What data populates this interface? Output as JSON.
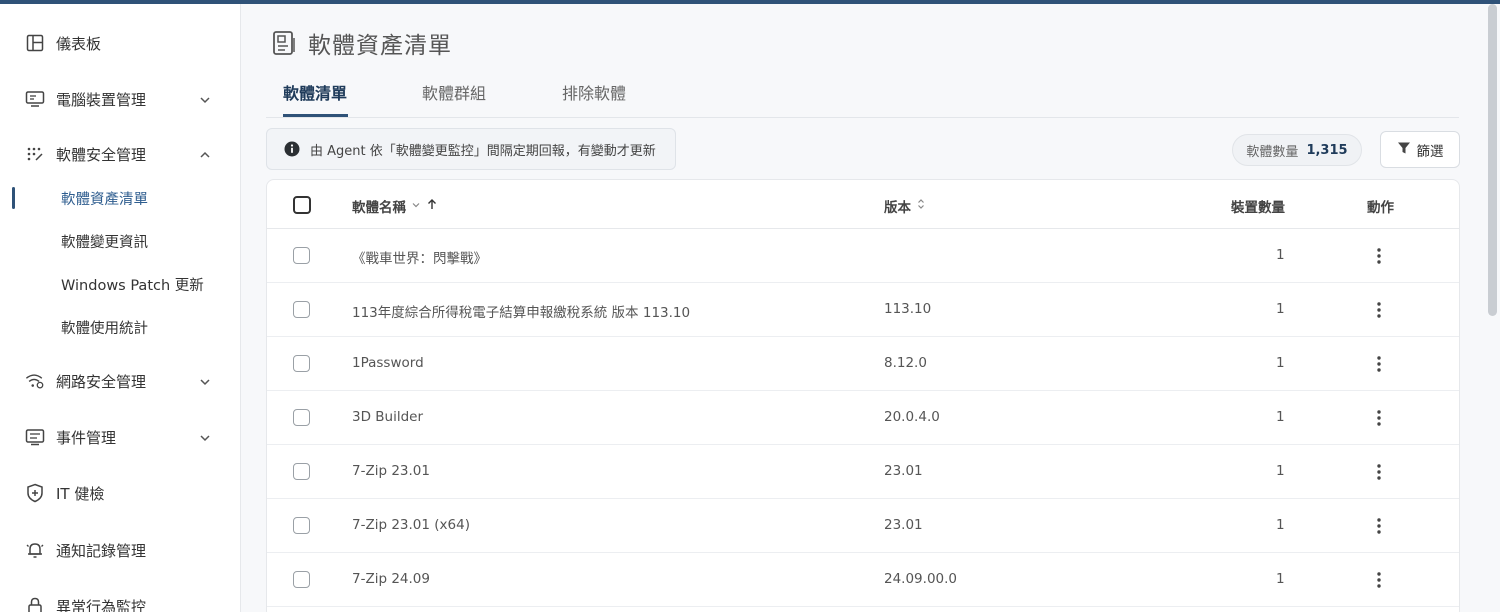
{
  "sidebar": {
    "items": [
      {
        "label": "儀表板",
        "icon": "layout-icon"
      },
      {
        "label": "電腦裝置管理",
        "icon": "monitor-icon"
      },
      {
        "label": "軟體安全管理",
        "icon": "apps-icon"
      },
      {
        "label": "網路安全管理",
        "icon": "wifi-gear-icon"
      },
      {
        "label": "事件管理",
        "icon": "list-icon"
      },
      {
        "label": "IT 健檢",
        "icon": "shield-plus-icon"
      },
      {
        "label": "通知記錄管理",
        "icon": "bell-icon"
      },
      {
        "label": "異常行為監控",
        "icon": "lock-icon"
      }
    ],
    "subitems": [
      {
        "label": "軟體資產清單"
      },
      {
        "label": "軟體變更資訊"
      },
      {
        "label": "Windows Patch 更新"
      },
      {
        "label": "軟體使用統計"
      }
    ]
  },
  "page": {
    "title": "軟體資產清單"
  },
  "tabs": [
    {
      "label": "軟體清單"
    },
    {
      "label": "軟體群組"
    },
    {
      "label": "排除軟體"
    }
  ],
  "notice": {
    "text": "由 Agent 依「軟體變更監控」間隔定期回報，有變動才更新"
  },
  "count": {
    "label": "軟體數量",
    "value": "1,315"
  },
  "filter": {
    "label": "篩選"
  },
  "table": {
    "columns": {
      "name": "軟體名稱",
      "version": "版本",
      "devices": "裝置數量",
      "actions": "動作"
    },
    "rows": [
      {
        "name": "《戰車世界：閃擊戰》",
        "version": "",
        "devices": "1"
      },
      {
        "name": "113年度綜合所得稅電子結算申報繳稅系統 版本 113.10",
        "version": "113.10",
        "devices": "1"
      },
      {
        "name": "1Password",
        "version": "8.12.0",
        "devices": "1"
      },
      {
        "name": "3D Builder",
        "version": "20.0.4.0",
        "devices": "1"
      },
      {
        "name": "7-Zip 23.01",
        "version": "23.01",
        "devices": "1"
      },
      {
        "name": "7-Zip 23.01 (x64)",
        "version": "23.01",
        "devices": "1"
      },
      {
        "name": "7-Zip 24.09",
        "version": "24.09.00.0",
        "devices": "1"
      }
    ]
  },
  "colors": {
    "brand": "#2f5278",
    "active_text": "#2e5d8f"
  }
}
